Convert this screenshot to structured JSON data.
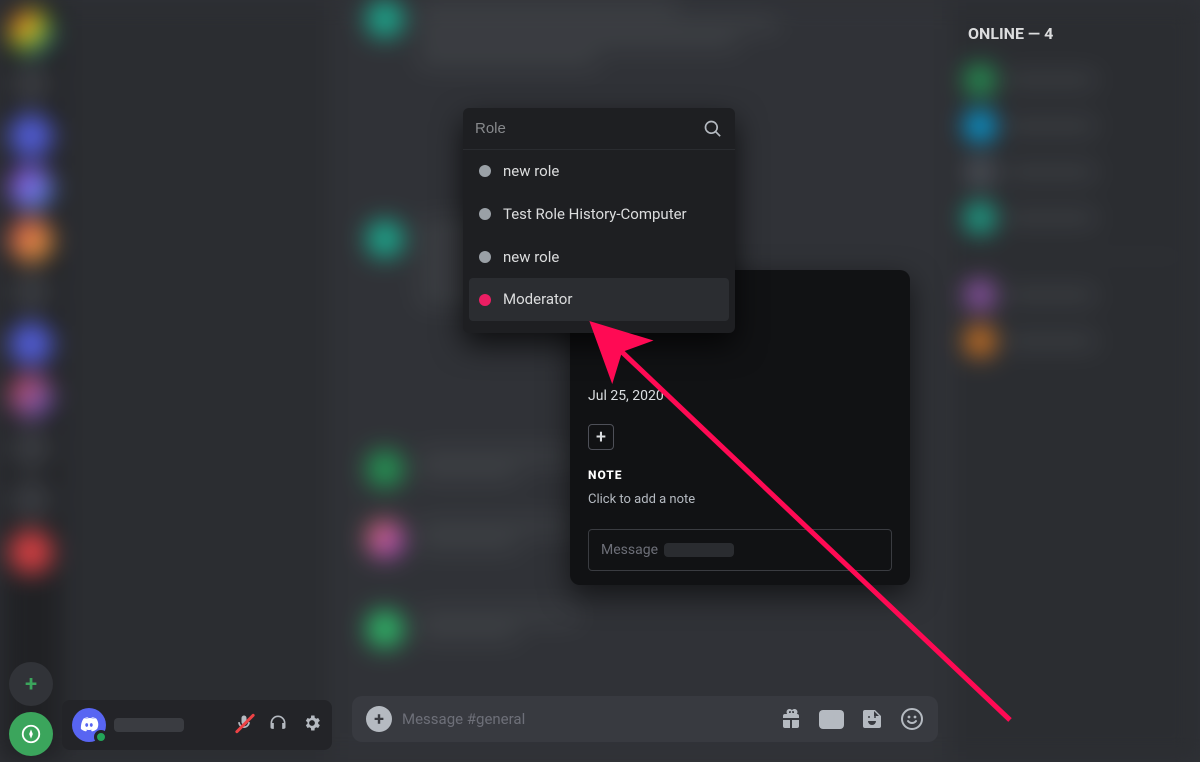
{
  "server_rail": {
    "add_label": "+",
    "explore_label": "✦"
  },
  "user_footer": {
    "mic_tooltip": "Mute",
    "headphones_tooltip": "Deafen",
    "settings_tooltip": "User Settings"
  },
  "role_popover": {
    "search_placeholder": "Role",
    "items": [
      {
        "label": "new role",
        "color": "#9aa0a6"
      },
      {
        "label": "Test Role History-Computer",
        "color": "#9aa0a6"
      },
      {
        "label": "new role",
        "color": "#9aa0a6"
      },
      {
        "label": "Moderator",
        "color": "#eb1e63"
      }
    ]
  },
  "profile_card": {
    "member_since": "Jul 25, 2020",
    "add_role_label": "+",
    "note_heading": "NOTE",
    "note_placeholder": "Click to add a note",
    "dm_placeholder_prefix": "Message"
  },
  "message_input": {
    "attach_label": "+",
    "placeholder": "Message #general",
    "gif_label": "GIF"
  },
  "members_panel": {
    "heading": "ONLINE — 4"
  }
}
